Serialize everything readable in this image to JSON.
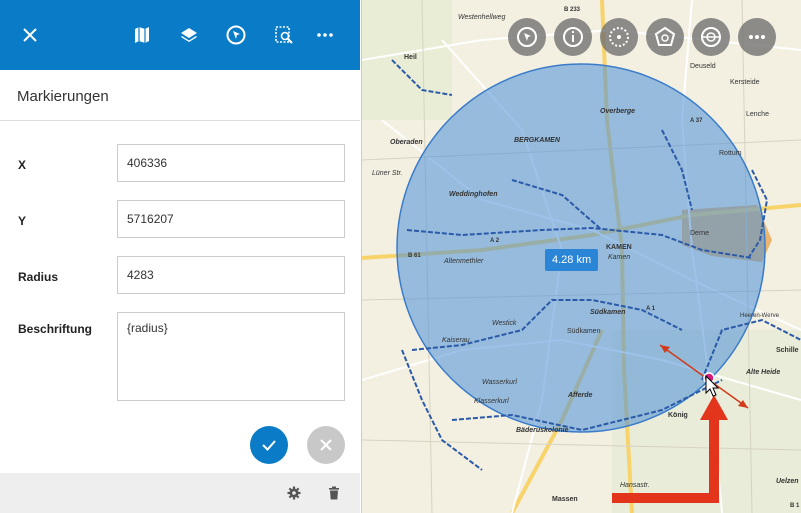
{
  "panel": {
    "title": "Markierungen",
    "fields": {
      "x": {
        "label": "X",
        "value": "406336"
      },
      "y": {
        "label": "Y",
        "value": "5716207"
      },
      "radius": {
        "label": "Radius",
        "value": "4283"
      },
      "beschriftung": {
        "label": "Beschriftung",
        "value": "{radius}"
      }
    }
  },
  "toolbar": {
    "close": "close-icon",
    "tools": [
      "map-icon",
      "layers-icon",
      "navigate-icon",
      "search-map-icon",
      "more-icon"
    ],
    "accent": "#0a7bc7"
  },
  "map": {
    "distance_label": "4.28 km",
    "circle_color": "#4a90d9",
    "labels": {
      "bergkamen": "BERGKAMEN",
      "overberge": "Overberge",
      "kamen": "KAMEN",
      "kamen_small": "Kamen",
      "sudkamen": "Südkamen",
      "heeren_werve": "Heeren-Werve",
      "alte_heide": "Alte Heide",
      "massen": "Massen",
      "afferde": "Afferde",
      "derne": "Derne",
      "oberaden": "Oberaden",
      "weddinghofen": "Weddinghofen",
      "westick": "Westick",
      "kaiserau": "Kaiserau",
      "wasserkurl": "Wasserkurl",
      "lunener_str": "Lüner Str.",
      "altenmethler": "Altenmethler",
      "b233": "B 233",
      "b1": "B 1",
      "deuseld": "Deuseld",
      "kersteide": "Kersteide",
      "westenhellweg": "Westenhellweg",
      "hansastr": "Hansastr.",
      "heil": "Heil",
      "schille": "Schille",
      "uelzen": "Uelzen",
      "rottum": "Rottum",
      "lenche": "Lenche",
      "a2": "A 2",
      "b61": "B 61",
      "a1": "A 1",
      "a37": "A 37",
      "sudkamen_label": "Südkamen",
      "baderuskolonie": "Bäderuskolonie",
      "klasserkurl": "Klasserkurl",
      "konig": "König"
    },
    "tools": [
      "pointer-icon",
      "info-icon",
      "circle-draw-icon",
      "polygon-icon",
      "measure-icon",
      "more-icon"
    ]
  },
  "footer": {
    "settings": "gear-icon",
    "delete": "trash-icon"
  }
}
